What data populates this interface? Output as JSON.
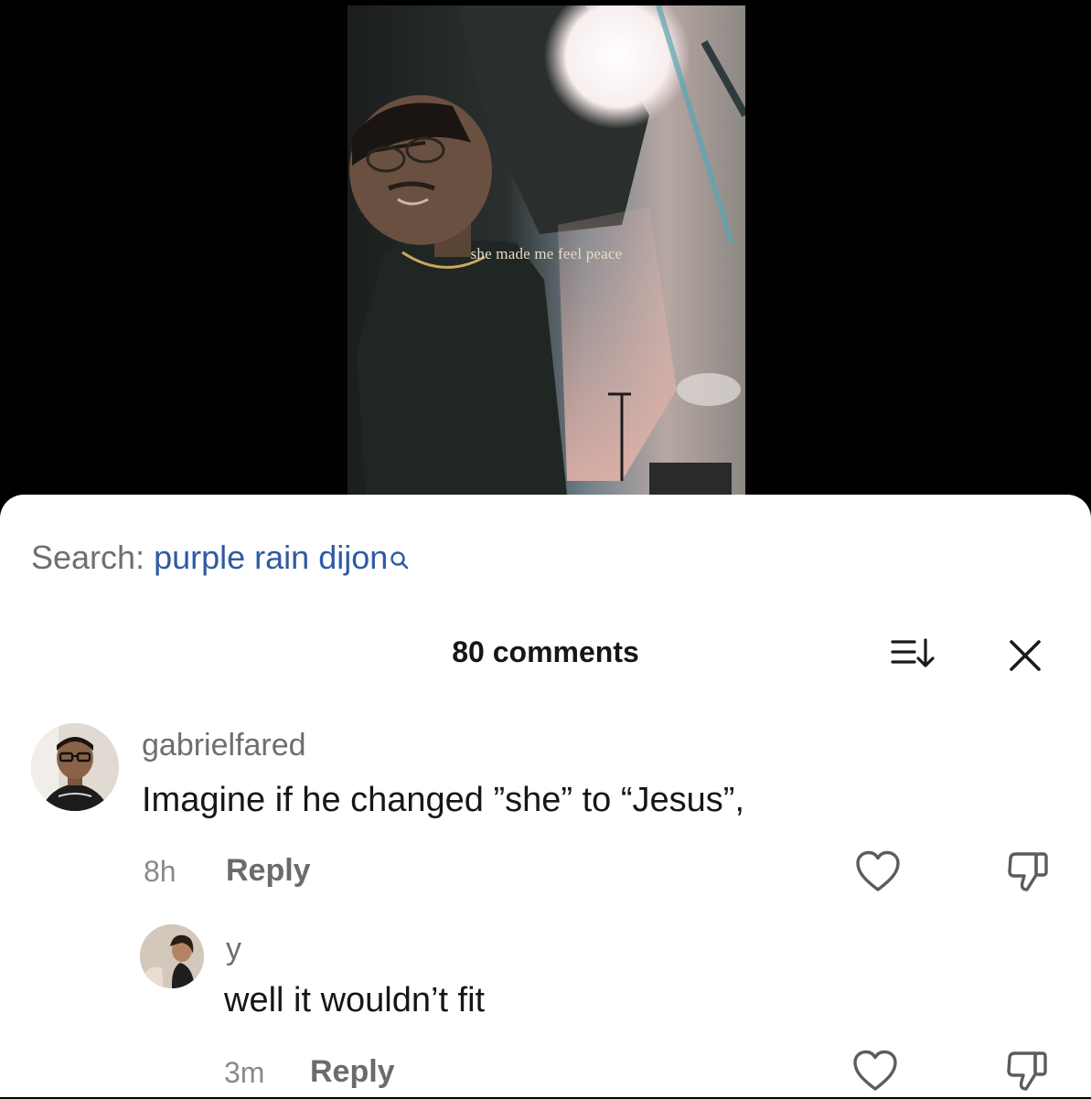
{
  "video": {
    "caption": "she made me feel peace"
  },
  "comments_sheet": {
    "search": {
      "prefix": "Search:",
      "term": "purple rain dijon",
      "icon": "search-icon"
    },
    "header": {
      "title": "80 comments",
      "sort_icon": "sort-icon",
      "close_icon": "close-icon"
    },
    "comments": [
      {
        "username": "gabrielfared",
        "text": "Imagine if he changed ”she” to “Jesus”,",
        "time": "8h",
        "reply_label": "Reply",
        "like_icon": "heart-icon",
        "dislike_icon": "thumbs-down-icon"
      },
      {
        "username": "y",
        "text": "well it wouldn’t fit",
        "time": "3m",
        "reply_label": "Reply",
        "like_icon": "heart-icon",
        "dislike_icon": "thumbs-down-icon"
      }
    ]
  },
  "colors": {
    "search_term": "#2f5aa3",
    "text_primary": "#161616",
    "text_secondary": "#6e6e6e",
    "icon_gray": "#5c5c5c"
  }
}
